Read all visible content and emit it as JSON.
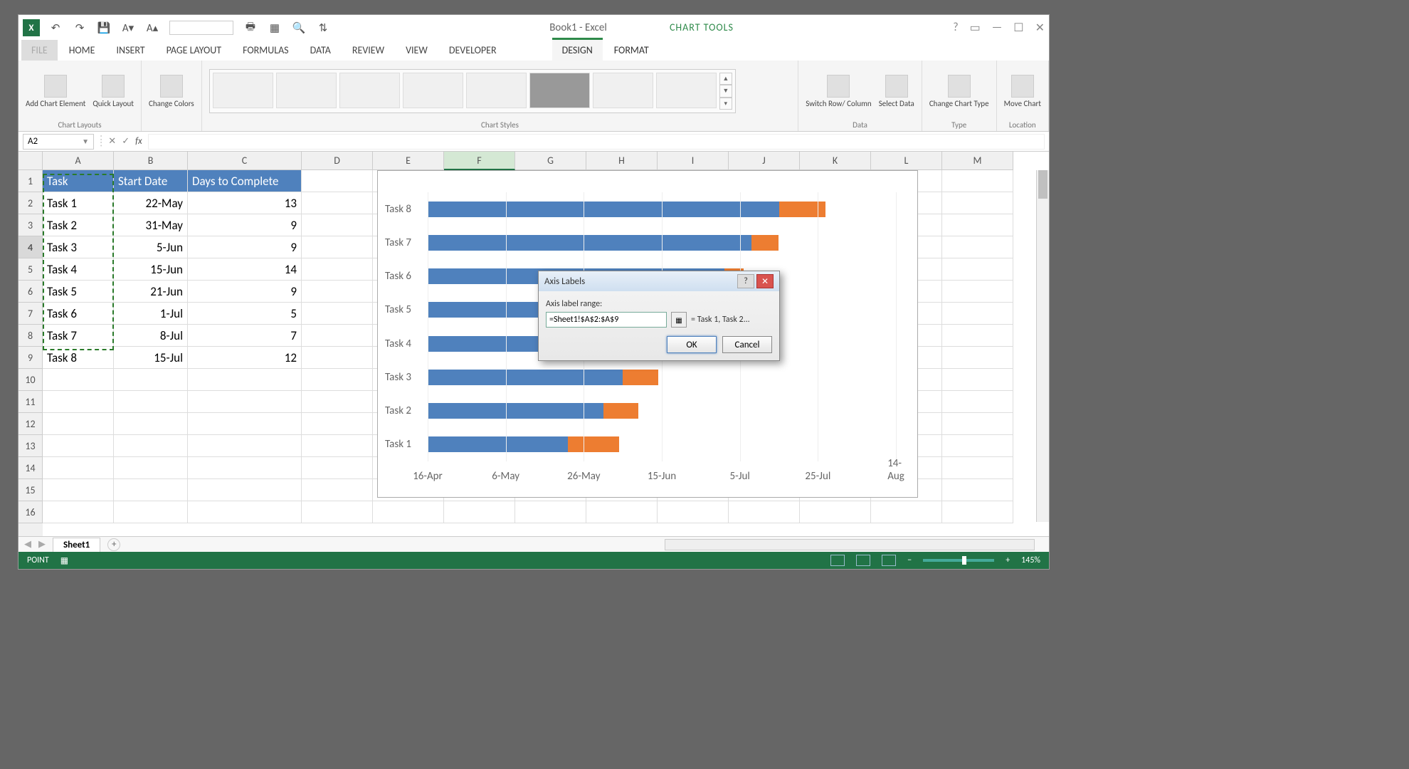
{
  "app_title": "Book1 - Excel",
  "tool_context": "CHART TOOLS",
  "tabs": [
    "FILE",
    "HOME",
    "INSERT",
    "PAGE LAYOUT",
    "FORMULAS",
    "DATA",
    "REVIEW",
    "VIEW",
    "DEVELOPER",
    "DESIGN",
    "FORMAT"
  ],
  "active_tab": "DESIGN",
  "ribbon": {
    "chart_layouts": {
      "label": "Chart Layouts",
      "add_element": "Add Chart Element",
      "quick_layout": "Quick Layout"
    },
    "change_colors": "Change Colors",
    "chart_styles_label": "Chart Styles",
    "data": {
      "label": "Data",
      "switch": "Switch Row/\nColumn",
      "select": "Select Data"
    },
    "type": {
      "label": "Type",
      "change": "Change Chart Type"
    },
    "location": {
      "label": "Location",
      "move": "Move Chart"
    }
  },
  "namebox": "A2",
  "columns": [
    "A",
    "B",
    "C",
    "D",
    "E",
    "F",
    "G",
    "H",
    "I",
    "J",
    "K",
    "L",
    "M"
  ],
  "rows": 16,
  "visible_row_count": 16,
  "highlighted_col": "F",
  "highlighted_row": 4,
  "table": {
    "headers": [
      "Task",
      "Start Date",
      "Days to Complete"
    ],
    "rows": [
      [
        "Task 1",
        "22-May",
        "13"
      ],
      [
        "Task 2",
        "31-May",
        "9"
      ],
      [
        "Task 3",
        "5-Jun",
        "9"
      ],
      [
        "Task 4",
        "15-Jun",
        "14"
      ],
      [
        "Task 5",
        "21-Jun",
        "9"
      ],
      [
        "Task 6",
        "1-Jul",
        "5"
      ],
      [
        "Task 7",
        "8-Jul",
        "7"
      ],
      [
        "Task 8",
        "15-Jul",
        "12"
      ]
    ]
  },
  "sheet_tab": "Sheet1",
  "status_mode": "POINT",
  "zoom": "145%",
  "dialog": {
    "title": "Axis Labels",
    "range_label": "Axis label range:",
    "range_value": "=Sheet1!$A$2:$A$9",
    "preview": "= Task 1, Task 2...",
    "ok": "OK",
    "cancel": "Cancel"
  },
  "chart_data": {
    "type": "bar",
    "orientation": "horizontal",
    "stacked": true,
    "categories": [
      "Task 1",
      "Task 2",
      "Task 3",
      "Task 4",
      "Task 5",
      "Task 6",
      "Task 7",
      "Task 8"
    ],
    "x_labels": [
      "16-Apr",
      "6-May",
      "26-May",
      "15-Jun",
      "5-Jul",
      "25-Jul",
      "14-Aug"
    ],
    "x_numeric": [
      42110,
      42130,
      42150,
      42170,
      42190,
      42210,
      42230
    ],
    "xlim": [
      42110,
      42230
    ],
    "series": [
      {
        "name": "Start Date",
        "color": "#4f81bd",
        "values": [
          42146,
          42155,
          42160,
          42170,
          42176,
          42186,
          42193,
          42200
        ]
      },
      {
        "name": "Days to Complete",
        "color": "#ed7d31",
        "values": [
          13,
          9,
          9,
          14,
          9,
          5,
          7,
          12
        ]
      }
    ],
    "title": "",
    "xlabel": "",
    "ylabel": ""
  }
}
